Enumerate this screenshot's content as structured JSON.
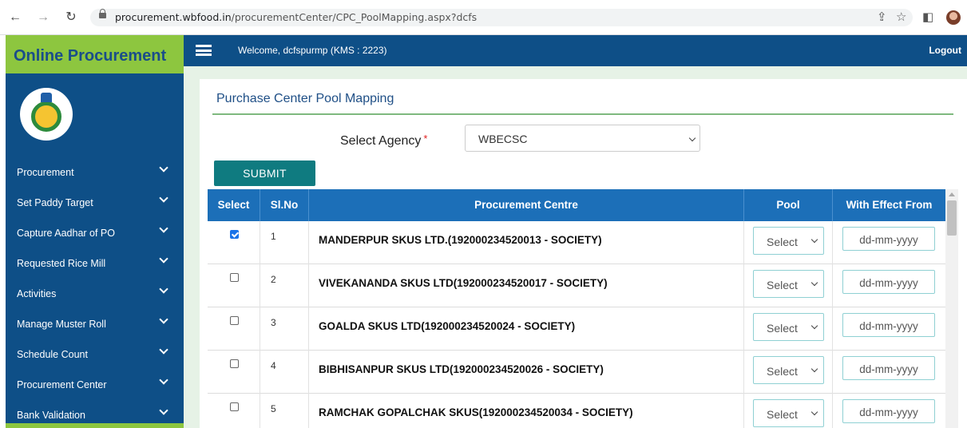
{
  "browser": {
    "url_host": "procurement.wbfood.in",
    "url_path": "/procurementCenter/CPC_PoolMapping.aspx?dcfs"
  },
  "app": {
    "brand": "Online Procurement",
    "welcome": "Welcome, dcfspurmp (KMS : 2223)",
    "logout": "Logout"
  },
  "sidebar": {
    "items": [
      {
        "label": "Procurement"
      },
      {
        "label": "Set Paddy Target"
      },
      {
        "label": "Capture Aadhar of PO"
      },
      {
        "label": "Requested Rice Mill"
      },
      {
        "label": "Activities"
      },
      {
        "label": "Manage Muster Roll"
      },
      {
        "label": "Schedule Count"
      },
      {
        "label": "Procurement Center"
      },
      {
        "label": "Bank Validation"
      }
    ]
  },
  "page": {
    "title": "Purchase Center Pool Mapping",
    "agency_label": "Select Agency",
    "agency_required": "*",
    "agency_value": "WBECSC",
    "submit_label": "SUBMIT"
  },
  "table": {
    "headers": {
      "select": "Select",
      "slno": "Sl.No",
      "centre": "Procurement Centre",
      "pool": "Pool",
      "effect": "With Effect From"
    },
    "rows": [
      {
        "checked": true,
        "slno": "1",
        "centre": "MANDERPUR SKUS LTD.(192000234520013 - SOCIETY)",
        "pool": "Select",
        "date_placeholder": "dd-mm-yyyy"
      },
      {
        "checked": false,
        "slno": "2",
        "centre": "VIVEKANANDA SKUS LTD(192000234520017 - SOCIETY)",
        "pool": "Select",
        "date_placeholder": "dd-mm-yyyy"
      },
      {
        "checked": false,
        "slno": "3",
        "centre": "GOALDA SKUS LTD(192000234520024 - SOCIETY)",
        "pool": "Select",
        "date_placeholder": "dd-mm-yyyy"
      },
      {
        "checked": false,
        "slno": "4",
        "centre": "BIBHISANPUR SKUS LTD(192000234520026 - SOCIETY)",
        "pool": "Select",
        "date_placeholder": "dd-mm-yyyy"
      },
      {
        "checked": false,
        "slno": "5",
        "centre": "RAMCHAK GOPALCHAK SKUS(192000234520034 - SOCIETY)",
        "pool": "Select",
        "date_placeholder": "dd-mm-yyyy"
      }
    ]
  },
  "colors": {
    "brand_green": "#8dc63f",
    "nav_blue": "#0e4f87",
    "header_blue": "#1c6fb8",
    "submit_teal": "#0f7b80"
  }
}
